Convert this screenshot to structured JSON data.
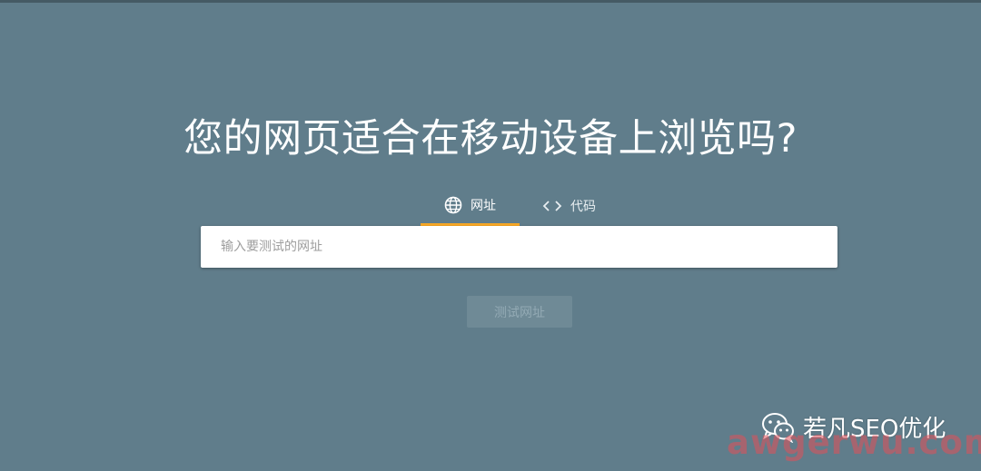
{
  "colors": {
    "background": "#607d8b",
    "active_tab_indicator": "#f9a825",
    "input_background": "#ffffff",
    "button_disabled": "#6f8a96"
  },
  "page": {
    "title": "您的网页适合在移动设备上浏览吗?"
  },
  "tabs": [
    {
      "label": "网址",
      "icon": "globe-icon",
      "active": true
    },
    {
      "label": "代码",
      "icon": "code-brackets-icon",
      "active": false
    }
  ],
  "url_input": {
    "value": "",
    "placeholder": "输入要测试的网址"
  },
  "test_button": {
    "label": "测试网址",
    "disabled": true
  },
  "watermark": {
    "account": "若凡SEO优化",
    "icon": "wechat-icon",
    "site": "awgerwu.com"
  }
}
